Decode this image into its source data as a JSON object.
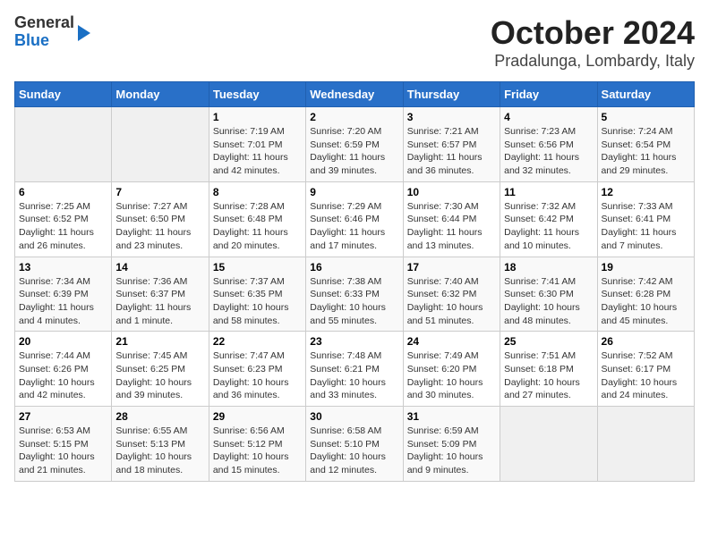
{
  "logo": {
    "general": "General",
    "blue": "Blue"
  },
  "title": "October 2024",
  "subtitle": "Pradalunga, Lombardy, Italy",
  "weekdays": [
    "Sunday",
    "Monday",
    "Tuesday",
    "Wednesday",
    "Thursday",
    "Friday",
    "Saturday"
  ],
  "weeks": [
    [
      {
        "day": "",
        "info": ""
      },
      {
        "day": "",
        "info": ""
      },
      {
        "day": "1",
        "info": "Sunrise: 7:19 AM\nSunset: 7:01 PM\nDaylight: 11 hours and 42 minutes."
      },
      {
        "day": "2",
        "info": "Sunrise: 7:20 AM\nSunset: 6:59 PM\nDaylight: 11 hours and 39 minutes."
      },
      {
        "day": "3",
        "info": "Sunrise: 7:21 AM\nSunset: 6:57 PM\nDaylight: 11 hours and 36 minutes."
      },
      {
        "day": "4",
        "info": "Sunrise: 7:23 AM\nSunset: 6:56 PM\nDaylight: 11 hours and 32 minutes."
      },
      {
        "day": "5",
        "info": "Sunrise: 7:24 AM\nSunset: 6:54 PM\nDaylight: 11 hours and 29 minutes."
      }
    ],
    [
      {
        "day": "6",
        "info": "Sunrise: 7:25 AM\nSunset: 6:52 PM\nDaylight: 11 hours and 26 minutes."
      },
      {
        "day": "7",
        "info": "Sunrise: 7:27 AM\nSunset: 6:50 PM\nDaylight: 11 hours and 23 minutes."
      },
      {
        "day": "8",
        "info": "Sunrise: 7:28 AM\nSunset: 6:48 PM\nDaylight: 11 hours and 20 minutes."
      },
      {
        "day": "9",
        "info": "Sunrise: 7:29 AM\nSunset: 6:46 PM\nDaylight: 11 hours and 17 minutes."
      },
      {
        "day": "10",
        "info": "Sunrise: 7:30 AM\nSunset: 6:44 PM\nDaylight: 11 hours and 13 minutes."
      },
      {
        "day": "11",
        "info": "Sunrise: 7:32 AM\nSunset: 6:42 PM\nDaylight: 11 hours and 10 minutes."
      },
      {
        "day": "12",
        "info": "Sunrise: 7:33 AM\nSunset: 6:41 PM\nDaylight: 11 hours and 7 minutes."
      }
    ],
    [
      {
        "day": "13",
        "info": "Sunrise: 7:34 AM\nSunset: 6:39 PM\nDaylight: 11 hours and 4 minutes."
      },
      {
        "day": "14",
        "info": "Sunrise: 7:36 AM\nSunset: 6:37 PM\nDaylight: 11 hours and 1 minute."
      },
      {
        "day": "15",
        "info": "Sunrise: 7:37 AM\nSunset: 6:35 PM\nDaylight: 10 hours and 58 minutes."
      },
      {
        "day": "16",
        "info": "Sunrise: 7:38 AM\nSunset: 6:33 PM\nDaylight: 10 hours and 55 minutes."
      },
      {
        "day": "17",
        "info": "Sunrise: 7:40 AM\nSunset: 6:32 PM\nDaylight: 10 hours and 51 minutes."
      },
      {
        "day": "18",
        "info": "Sunrise: 7:41 AM\nSunset: 6:30 PM\nDaylight: 10 hours and 48 minutes."
      },
      {
        "day": "19",
        "info": "Sunrise: 7:42 AM\nSunset: 6:28 PM\nDaylight: 10 hours and 45 minutes."
      }
    ],
    [
      {
        "day": "20",
        "info": "Sunrise: 7:44 AM\nSunset: 6:26 PM\nDaylight: 10 hours and 42 minutes."
      },
      {
        "day": "21",
        "info": "Sunrise: 7:45 AM\nSunset: 6:25 PM\nDaylight: 10 hours and 39 minutes."
      },
      {
        "day": "22",
        "info": "Sunrise: 7:47 AM\nSunset: 6:23 PM\nDaylight: 10 hours and 36 minutes."
      },
      {
        "day": "23",
        "info": "Sunrise: 7:48 AM\nSunset: 6:21 PM\nDaylight: 10 hours and 33 minutes."
      },
      {
        "day": "24",
        "info": "Sunrise: 7:49 AM\nSunset: 6:20 PM\nDaylight: 10 hours and 30 minutes."
      },
      {
        "day": "25",
        "info": "Sunrise: 7:51 AM\nSunset: 6:18 PM\nDaylight: 10 hours and 27 minutes."
      },
      {
        "day": "26",
        "info": "Sunrise: 7:52 AM\nSunset: 6:17 PM\nDaylight: 10 hours and 24 minutes."
      }
    ],
    [
      {
        "day": "27",
        "info": "Sunrise: 6:53 AM\nSunset: 5:15 PM\nDaylight: 10 hours and 21 minutes."
      },
      {
        "day": "28",
        "info": "Sunrise: 6:55 AM\nSunset: 5:13 PM\nDaylight: 10 hours and 18 minutes."
      },
      {
        "day": "29",
        "info": "Sunrise: 6:56 AM\nSunset: 5:12 PM\nDaylight: 10 hours and 15 minutes."
      },
      {
        "day": "30",
        "info": "Sunrise: 6:58 AM\nSunset: 5:10 PM\nDaylight: 10 hours and 12 minutes."
      },
      {
        "day": "31",
        "info": "Sunrise: 6:59 AM\nSunset: 5:09 PM\nDaylight: 10 hours and 9 minutes."
      },
      {
        "day": "",
        "info": ""
      },
      {
        "day": "",
        "info": ""
      }
    ]
  ]
}
